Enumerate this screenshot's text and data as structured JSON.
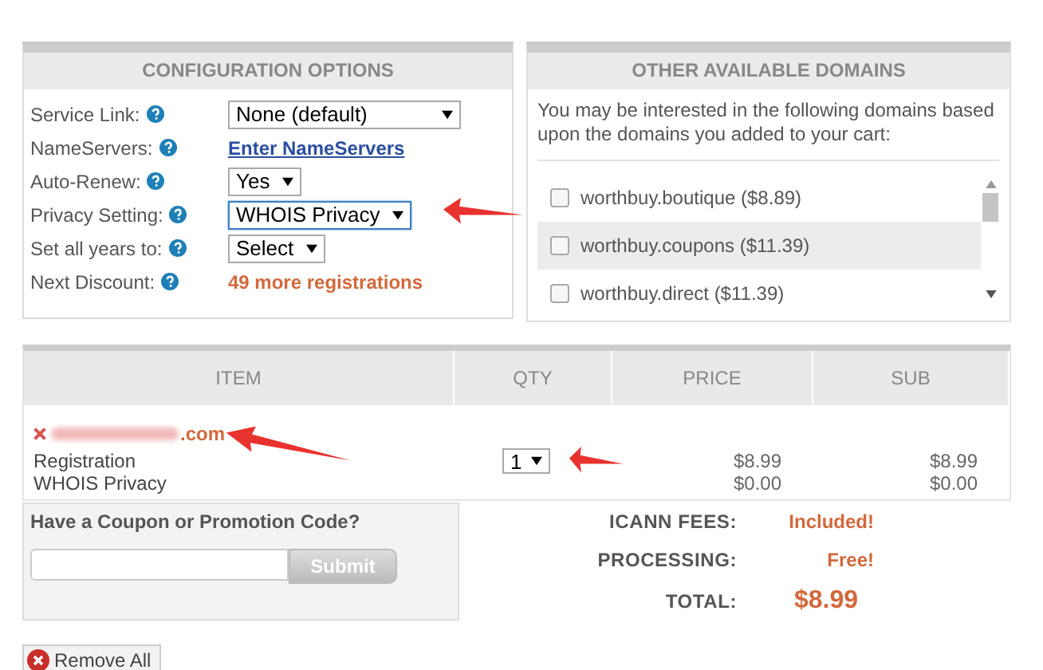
{
  "configuration": {
    "title": "CONFIGURATION OPTIONS",
    "rows": [
      {
        "label": "Service Link:",
        "kind": "select",
        "value": "None (default)",
        "wide": true,
        "focused": false
      },
      {
        "label": "NameServers:",
        "kind": "link",
        "value": "Enter NameServers"
      },
      {
        "label": "Auto-Renew:",
        "kind": "select",
        "value": "Yes",
        "wide": false,
        "focused": false
      },
      {
        "label": "Privacy Setting:",
        "kind": "select",
        "value": "WHOIS Privacy",
        "wide": false,
        "focused": true
      },
      {
        "label": "Set all years to:",
        "kind": "select",
        "value": "Select",
        "wide": false,
        "focused": false
      },
      {
        "label": "Next Discount:",
        "kind": "note",
        "value": "49 more registrations"
      }
    ]
  },
  "other_domains": {
    "title": "OTHER AVAILABLE DOMAINS",
    "intro": "You may be interested in the following domains based upon the domains you added to your cart:",
    "items": [
      {
        "label": "worthbuy.boutique ($8.89)",
        "checked": false,
        "selected": false
      },
      {
        "label": "worthbuy.coupons ($11.39)",
        "checked": false,
        "selected": true
      },
      {
        "label": "worthbuy.direct ($11.39)",
        "checked": false,
        "selected": false
      }
    ]
  },
  "cart": {
    "columns": [
      "ITEM",
      "QTY",
      "PRICE",
      "SUB"
    ],
    "domain_suffix": ".com",
    "qty": "1",
    "lines": [
      {
        "name": "Registration",
        "price": "$8.99",
        "sub": "$8.99"
      },
      {
        "name": "WHOIS Privacy",
        "price": "$0.00",
        "sub": "$0.00"
      }
    ]
  },
  "coupon": {
    "title": "Have a Coupon or Promotion Code?",
    "button": "Submit"
  },
  "totals": [
    {
      "label": "ICANN FEES:",
      "value": "Included!",
      "kind": "note"
    },
    {
      "label": "PROCESSING:",
      "value": "Free!",
      "kind": "note"
    },
    {
      "label": "TOTAL:",
      "value": "$8.99",
      "kind": "total"
    }
  ],
  "remove_all": "Remove All"
}
